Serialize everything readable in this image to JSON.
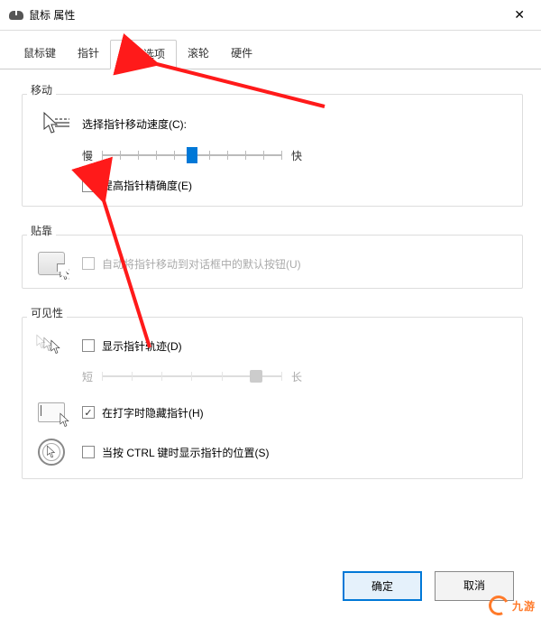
{
  "title": "鼠标 属性",
  "tabs": [
    "鼠标键",
    "指针",
    "指针选项",
    "滚轮",
    "硬件"
  ],
  "active_tab": 2,
  "motion": {
    "group_label": "移动",
    "speed_label": "选择指针移动速度(C):",
    "slow": "慢",
    "fast": "快",
    "enhance_precision": "提高指针精确度(E)",
    "enhance_checked": false
  },
  "snap": {
    "group_label": "贴靠",
    "label": "自动将指针移动到对话框中的默认按钮(U)",
    "checked": false
  },
  "visibility": {
    "group_label": "可见性",
    "trails_label": "显示指针轨迹(D)",
    "trails_checked": false,
    "short": "短",
    "long": "长",
    "hide_label": "在打字时隐藏指针(H)",
    "hide_checked": true,
    "ctrl_label": "当按 CTRL 键时显示指针的位置(S)",
    "ctrl_checked": false
  },
  "buttons": {
    "ok": "确定",
    "cancel": "取消"
  },
  "watermark": "九游"
}
